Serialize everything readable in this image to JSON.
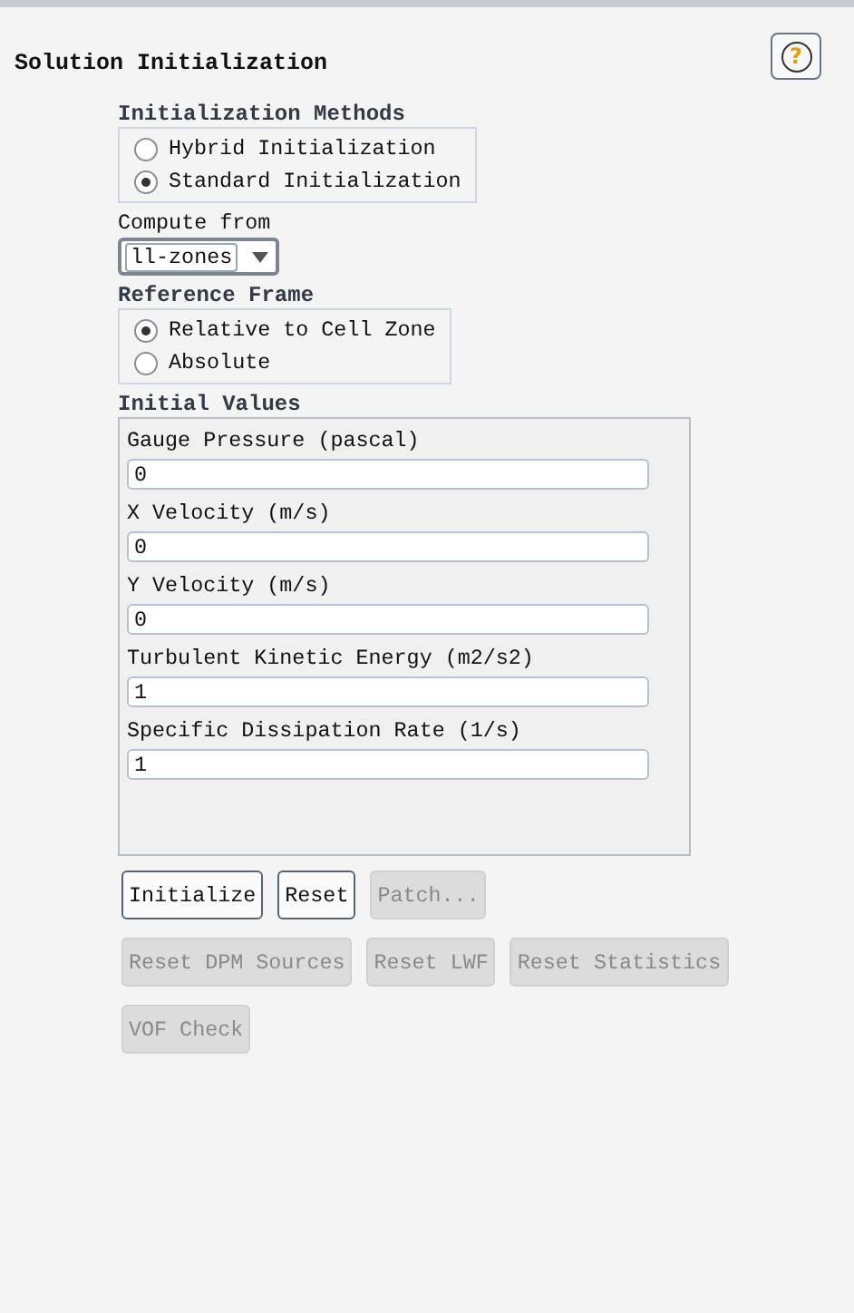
{
  "panel": {
    "title": "Solution Initialization",
    "help": "?"
  },
  "methods": {
    "title": "Initialization Methods",
    "options": [
      {
        "label": "Hybrid  Initialization",
        "selected": false
      },
      {
        "label": "Standard Initialization",
        "selected": true
      }
    ]
  },
  "compute_from": {
    "label": "Compute from",
    "value": "ll-zones"
  },
  "reference_frame": {
    "title": "Reference Frame",
    "options": [
      {
        "label": "Relative to Cell Zone",
        "selected": true
      },
      {
        "label": "Absolute",
        "selected": false
      }
    ]
  },
  "initial_values": {
    "title": "Initial Values",
    "fields": [
      {
        "label": "Gauge Pressure (pascal)",
        "value": "0"
      },
      {
        "label": "X Velocity (m/s)",
        "value": "0"
      },
      {
        "label": "Y Velocity (m/s)",
        "value": "0"
      },
      {
        "label": "Turbulent Kinetic Energy (m2/s2)",
        "value": "1"
      },
      {
        "label": "Specific Dissipation Rate (1/s)",
        "value": "1"
      }
    ]
  },
  "button_rows": [
    [
      {
        "label": "Initialize",
        "disabled": false
      },
      {
        "label": "Reset",
        "disabled": false
      },
      {
        "label": "Patch...",
        "disabled": true
      }
    ],
    [
      {
        "label": "Reset DPM Sources",
        "disabled": true
      },
      {
        "label": "Reset LWF",
        "disabled": true
      },
      {
        "label": "Reset Statistics",
        "disabled": true
      }
    ],
    [
      {
        "label": "VOF Check",
        "disabled": true
      }
    ]
  ]
}
